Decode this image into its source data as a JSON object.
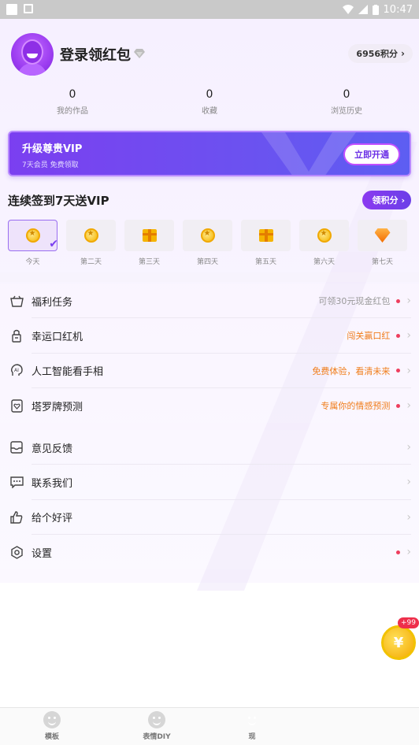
{
  "status_bar": {
    "time": "10:47"
  },
  "profile": {
    "login_title": "登录领红包",
    "points_label": "6956积分",
    "stats": [
      {
        "value": "0",
        "label": "我的作品"
      },
      {
        "value": "0",
        "label": "收藏"
      },
      {
        "value": "0",
        "label": "浏览历史"
      }
    ]
  },
  "vip": {
    "title": "升级尊贵VIP",
    "subtitle": "7天会员 免费领取",
    "button": "立即开通"
  },
  "checkin": {
    "title": "连续签到7天送VIP",
    "share_button": "领积分",
    "days": [
      {
        "label": "今天",
        "reward": "coin",
        "checked": true
      },
      {
        "label": "第二天",
        "reward": "coin",
        "checked": false
      },
      {
        "label": "第三天",
        "reward": "gift",
        "checked": false
      },
      {
        "label": "第四天",
        "reward": "coin",
        "checked": false
      },
      {
        "label": "第五天",
        "reward": "gift",
        "checked": false
      },
      {
        "label": "第六天",
        "reward": "coin",
        "checked": false
      },
      {
        "label": "第七天",
        "reward": "vip-gem",
        "checked": false
      }
    ]
  },
  "menu_group_1": [
    {
      "icon": "basket-icon",
      "label": "福利任务",
      "hint": "可领30元现金红包",
      "hint_style": "gray",
      "dot": true
    },
    {
      "icon": "slot-machine-icon",
      "label": "幸运口红机",
      "hint": "闯关赢口红",
      "hint_style": "orange",
      "dot": true
    },
    {
      "icon": "ai-face-icon",
      "label": "人工智能看手相",
      "hint": "免费体验，看清未来",
      "hint_style": "orange",
      "dot": true
    },
    {
      "icon": "tarot-card-icon",
      "label": "塔罗牌预测",
      "hint": "专属你的情感预测",
      "hint_style": "orange",
      "dot": true
    }
  ],
  "menu_group_2": [
    {
      "icon": "inbox-icon",
      "label": "意见反馈",
      "dot": false
    },
    {
      "icon": "chat-icon",
      "label": "联系我们",
      "dot": false
    },
    {
      "icon": "thumbs-up-icon",
      "label": "给个好评",
      "dot": false
    },
    {
      "icon": "settings-icon",
      "label": "设置",
      "dot": true
    }
  ],
  "floating_coin": {
    "symbol": "¥",
    "badge": "+99"
  },
  "tabbar": [
    {
      "label": "模板"
    },
    {
      "label": "表情DIY"
    },
    {
      "label": "现"
    }
  ],
  "colors": {
    "accent_purple": "#7b3ff0",
    "hint_orange": "#f07d1a",
    "dot_red": "#ee3e5e"
  }
}
